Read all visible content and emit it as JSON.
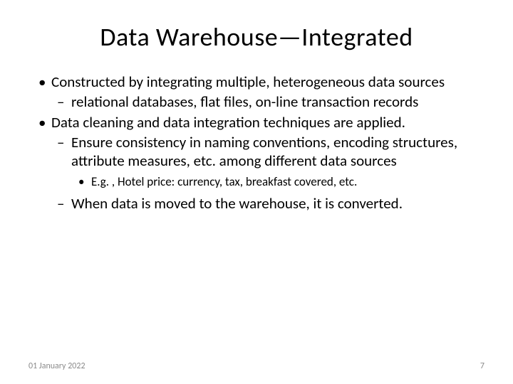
{
  "slide": {
    "title": "Data Warehouse—Integrated",
    "bullets": [
      {
        "level": 1,
        "text": "Constructed by integrating multiple, heterogeneous data sources"
      },
      {
        "level": 2,
        "text": "relational databases, flat files, on-line transaction records"
      },
      {
        "level": 1,
        "text": "Data cleaning and data integration techniques are applied."
      },
      {
        "level": 2,
        "text": "Ensure consistency in naming conventions, encoding structures, attribute measures, etc. among different data sources"
      },
      {
        "level": 3,
        "text": "E.g. , Hotel price: currency, tax, breakfast covered, etc."
      },
      {
        "level": 2,
        "text": "When data is moved to the warehouse, it is converted."
      }
    ],
    "footer": {
      "date": "01 January 2022",
      "page": "7"
    }
  }
}
